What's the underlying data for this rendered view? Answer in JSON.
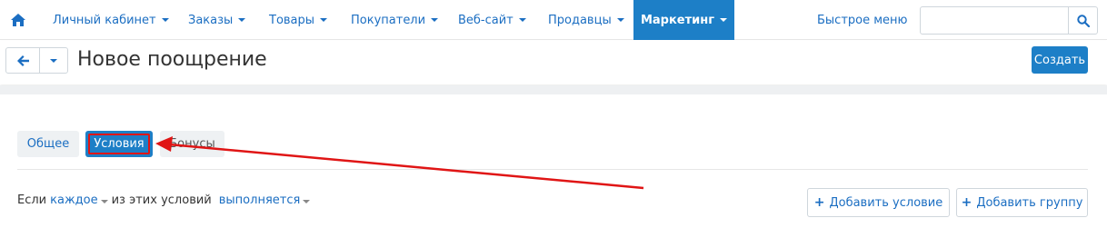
{
  "nav": {
    "home_icon": "home-icon",
    "items": [
      {
        "label": "Личный кабинет",
        "active": false
      },
      {
        "label": "Заказы",
        "active": false
      },
      {
        "label": "Товары",
        "active": false
      },
      {
        "label": "Покупатели",
        "active": false
      },
      {
        "label": "Веб-сайт",
        "active": false
      },
      {
        "label": "Продавцы",
        "active": false
      },
      {
        "label": "Маркетинг",
        "active": true
      }
    ],
    "quick_menu": "Быстрое меню",
    "search_placeholder": ""
  },
  "header": {
    "title": "Новое поощрение",
    "create_label": "Создать"
  },
  "tabs": [
    {
      "label": "Общее",
      "active": false
    },
    {
      "label": "Условия",
      "active": true
    },
    {
      "label": "Бонусы",
      "active": false
    }
  ],
  "conditions": {
    "prefix": "Если",
    "mode": "каждое",
    "middle": "из этих условий",
    "state": "выполняется",
    "add_condition": "Добавить условие",
    "add_group": "Добавить группу"
  },
  "colors": {
    "accent": "#1d7fc7",
    "highlight": "#e01515"
  }
}
